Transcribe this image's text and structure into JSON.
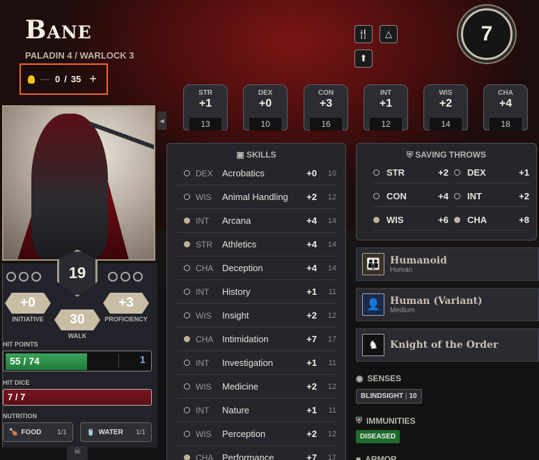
{
  "character": {
    "name": "Bane",
    "classes": "PALADIN 4 / WARLOCK 3",
    "level": "7"
  },
  "inspiration": {
    "current": "0",
    "separator": "/",
    "max": "35",
    "add": "+",
    "dash": "—"
  },
  "header_icons": [
    {
      "icon": "utensils-icon"
    },
    {
      "icon": "camp-icon"
    },
    {
      "icon": "arrow-up-circle-icon"
    }
  ],
  "abilities": [
    {
      "abbr": "STR",
      "mod": "+1",
      "score": "13"
    },
    {
      "abbr": "DEX",
      "mod": "+0",
      "score": "10"
    },
    {
      "abbr": "CON",
      "mod": "+3",
      "score": "16"
    },
    {
      "abbr": "INT",
      "mod": "+1",
      "score": "12"
    },
    {
      "abbr": "WIS",
      "mod": "+2",
      "score": "14"
    },
    {
      "abbr": "CHA",
      "mod": "+4",
      "score": "18"
    }
  ],
  "combat": {
    "ac": "19",
    "initiative": {
      "value": "+0",
      "label": "INITIATIVE"
    },
    "proficiency": {
      "value": "+3",
      "label": "PROFICIENCY"
    },
    "walk": {
      "value": "30",
      "label": "WALK"
    }
  },
  "hit_points": {
    "label": "HIT POINTS",
    "text": "55 / 74",
    "temp": "1",
    "fraction": 0.743
  },
  "hit_dice": {
    "label": "HIT DICE",
    "text": "7 / 7"
  },
  "nutrition": {
    "label": "NUTRITION",
    "food": {
      "label": "FOOD",
      "count": "1/1"
    },
    "water": {
      "label": "WATER",
      "count": "1/1"
    }
  },
  "skills": {
    "title": "SKILLS",
    "rows": [
      {
        "ability": "DEX",
        "name": "Acrobatics",
        "bonus": "+0",
        "passive": "10",
        "proficient": false
      },
      {
        "ability": "WIS",
        "name": "Animal Handling",
        "bonus": "+2",
        "passive": "12",
        "proficient": false
      },
      {
        "ability": "INT",
        "name": "Arcana",
        "bonus": "+4",
        "passive": "14",
        "proficient": true
      },
      {
        "ability": "STR",
        "name": "Athletics",
        "bonus": "+4",
        "passive": "14",
        "proficient": true
      },
      {
        "ability": "CHA",
        "name": "Deception",
        "bonus": "+4",
        "passive": "14",
        "proficient": false
      },
      {
        "ability": "INT",
        "name": "History",
        "bonus": "+1",
        "passive": "11",
        "proficient": false
      },
      {
        "ability": "WIS",
        "name": "Insight",
        "bonus": "+2",
        "passive": "12",
        "proficient": false
      },
      {
        "ability": "CHA",
        "name": "Intimidation",
        "bonus": "+7",
        "passive": "17",
        "proficient": true
      },
      {
        "ability": "INT",
        "name": "Investigation",
        "bonus": "+1",
        "passive": "11",
        "proficient": false
      },
      {
        "ability": "WIS",
        "name": "Medicine",
        "bonus": "+2",
        "passive": "12",
        "proficient": false
      },
      {
        "ability": "INT",
        "name": "Nature",
        "bonus": "+1",
        "passive": "11",
        "proficient": false
      },
      {
        "ability": "WIS",
        "name": "Perception",
        "bonus": "+2",
        "passive": "12",
        "proficient": false
      },
      {
        "ability": "CHA",
        "name": "Performance",
        "bonus": "+7",
        "passive": "17",
        "proficient": true
      }
    ]
  },
  "saving_throws": {
    "title": "SAVING THROWS",
    "rows": [
      {
        "ability": "STR",
        "bonus": "+2",
        "proficient": false
      },
      {
        "ability": "DEX",
        "bonus": "+1",
        "proficient": false
      },
      {
        "ability": "CON",
        "bonus": "+4",
        "proficient": false
      },
      {
        "ability": "INT",
        "bonus": "+2",
        "proficient": false
      },
      {
        "ability": "WIS",
        "bonus": "+6",
        "proficient": true
      },
      {
        "ability": "CHA",
        "bonus": "+8",
        "proficient": true
      }
    ]
  },
  "tags": [
    {
      "name": "Humanoid",
      "sub": "Human",
      "icon": "family-icon"
    },
    {
      "name": "Human (Variant)",
      "sub": "Medium",
      "icon": "person-portrait-icon"
    },
    {
      "name": "Knight of the Order",
      "sub": "",
      "icon": "knight-icon"
    }
  ],
  "senses": {
    "title": "SENSES",
    "items": [
      {
        "name": "BLINDSIGHT",
        "value": "10"
      }
    ]
  },
  "immunities": {
    "title": "IMMUNITIES",
    "items": [
      "DISEASED"
    ]
  },
  "armor": {
    "title": "ARMOR"
  },
  "colors": {
    "accent_orange": "#f26a21",
    "hp_green": "#2e8f4a",
    "hit_dice_red": "#6b1119",
    "immunity_green": "#1f6b2a"
  }
}
